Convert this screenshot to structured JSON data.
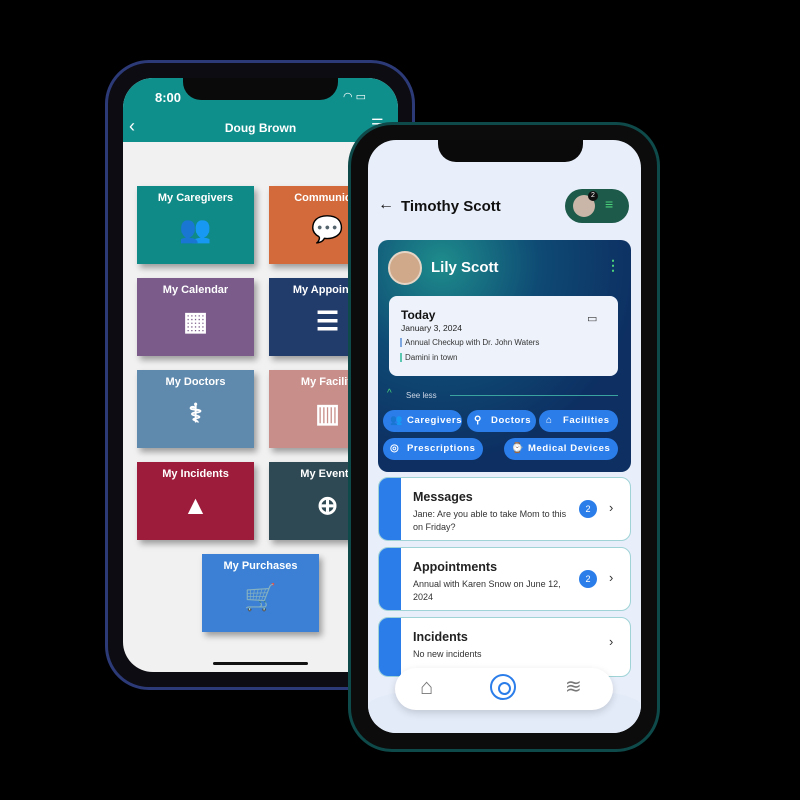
{
  "left_phone": {
    "time": "8:00",
    "title": "Doug Brown",
    "tiles": [
      {
        "label": "My Caregivers",
        "icon": "group-icon",
        "color": "#0f8a86"
      },
      {
        "label": "Communicat",
        "icon": "chat-bubbles-icon",
        "color": "#d26a3b"
      },
      {
        "label": "My Calendar",
        "icon": "calendar-icon",
        "color": "#7a5b8a"
      },
      {
        "label": "My Appointm",
        "icon": "clipboard-list-icon",
        "color": "#213b6b"
      },
      {
        "label": "My Doctors",
        "icon": "doctor-icon",
        "color": "#5f89ad"
      },
      {
        "label": "My Faciliti",
        "icon": "building-icon",
        "color": "#c88e89"
      },
      {
        "label": "My Incidents",
        "icon": "warning-icon",
        "color": "#9e1c3b"
      },
      {
        "label": "My Events",
        "icon": "globe-book-icon",
        "color": "#2e4953"
      },
      {
        "label": "My Purchases",
        "icon": "cart-icon",
        "color": "#3b80d4"
      }
    ]
  },
  "right_phone": {
    "title": "Timothy Scott",
    "avatar_badge": "2",
    "profile": {
      "name": "Lily Scott",
      "today_label": "Today",
      "date": "January 3, 2024",
      "events": [
        "Annual Checkup with Dr. John Waters",
        "Damini in town"
      ],
      "see_less": "See less"
    },
    "chips": [
      {
        "label": "Caregivers",
        "icon": "people-icon"
      },
      {
        "label": "Doctors",
        "icon": "person-add-icon"
      },
      {
        "label": "Facilities",
        "icon": "home-icon"
      },
      {
        "label": "Prescriptions",
        "icon": "pill-icon"
      },
      {
        "label": "Medical Devices",
        "icon": "watch-icon"
      }
    ],
    "cards": [
      {
        "title": "Messages",
        "desc": "Jane: Are you able to take Mom to this on Friday?",
        "badge": "2"
      },
      {
        "title": "Appointments",
        "desc": "Annual with Karen Snow on June 12, 2024",
        "badge": "2"
      },
      {
        "title": "Incidents",
        "desc": "No new incidents"
      }
    ],
    "nav": [
      "home-icon",
      "swirl-icon",
      "layers-icon"
    ],
    "colors": {
      "accent": "#2b7de9",
      "profile_bg": "#0d3a6a",
      "header_pill": "#1d5a4a"
    }
  }
}
